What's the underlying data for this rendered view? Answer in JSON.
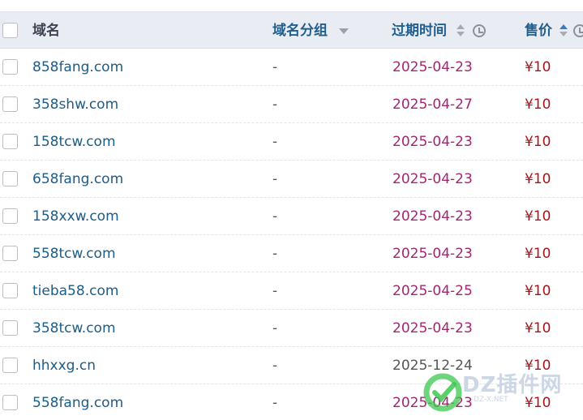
{
  "header": {
    "domain_label": "域名",
    "group_label": "域名分组",
    "expire_label": "过期时间",
    "price_label": "售价"
  },
  "rows": [
    {
      "domain": "858fang.com",
      "group": "-",
      "expire": "2025-04-23",
      "price": "¥10"
    },
    {
      "domain": "358shw.com",
      "group": "-",
      "expire": "2025-04-27",
      "price": "¥10"
    },
    {
      "domain": "158tcw.com",
      "group": "-",
      "expire": "2025-04-23",
      "price": "¥10"
    },
    {
      "domain": "658fang.com",
      "group": "-",
      "expire": "2025-04-23",
      "price": "¥10"
    },
    {
      "domain": "158xxw.com",
      "group": "-",
      "expire": "2025-04-23",
      "price": "¥10"
    },
    {
      "domain": "558tcw.com",
      "group": "-",
      "expire": "2025-04-23",
      "price": "¥10"
    },
    {
      "domain": "tieba58.com",
      "group": "-",
      "expire": "2025-04-25",
      "price": "¥10"
    },
    {
      "domain": "358tcw.com",
      "group": "-",
      "expire": "2025-04-23",
      "price": "¥10"
    },
    {
      "domain": "hhxxg.cn",
      "group": "-",
      "expire": "2025-12-24",
      "price": "¥10"
    },
    {
      "domain": "558fang.com",
      "group": "-",
      "expire": "2025-04-23",
      "price": "¥10"
    }
  ],
  "watermark": {
    "text": "DZ插件网",
    "sub": "DZ-X.NET"
  },
  "colors": {
    "header_bg": "#e9edf3",
    "link": "#1c5c88",
    "expire": "#a3266e",
    "price": "#a3151b"
  }
}
